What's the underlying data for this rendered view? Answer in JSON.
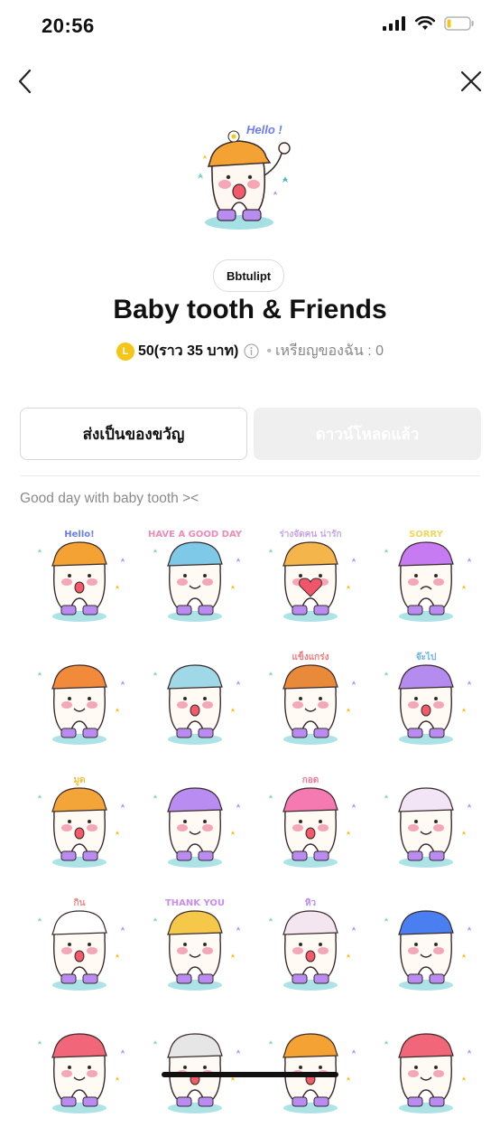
{
  "status_bar": {
    "time": "20:56"
  },
  "header": {
    "back_icon": "chevron-left-icon",
    "close_icon": "close-icon"
  },
  "sticker_pack": {
    "author": "Bbtulipt",
    "title": "Baby tooth & Friends",
    "coin_symbol": "L",
    "price": "50",
    "price_approx": "(ราว 35 บาท)",
    "my_coins": "เหรียญของฉัน : 0",
    "description": "Good day with baby tooth ><"
  },
  "actions": {
    "gift_label": "ส่งเป็นของขวัญ",
    "download_label": "ดาวน์โหลดแล้ว"
  },
  "stickers": [
    {
      "id": 1,
      "hat": "#f4a234",
      "text": "Hello!",
      "textColor": "#6b7cf6",
      "mouth": "open"
    },
    {
      "id": 2,
      "hat": "#7ec9e8",
      "text": "HAVE A GOOD DAY",
      "textColor": "#f08ab6",
      "mouth": "smile"
    },
    {
      "id": 3,
      "hat": "#f4b54a",
      "text": "ร่างจัดคน น่ารัก",
      "textColor": "#c9a4e6",
      "mouth": "heart"
    },
    {
      "id": 4,
      "hat": "#c77bf2",
      "text": "SORRY",
      "textColor": "#f3d55a",
      "mouth": "sad"
    },
    {
      "id": 5,
      "hat": "#f28a3c",
      "text": "",
      "textColor": "#999",
      "mouth": "smile"
    },
    {
      "id": 6,
      "hat": "#9fd8e6",
      "text": "",
      "textColor": "#999",
      "mouth": "open"
    },
    {
      "id": 7,
      "hat": "#e88a3a",
      "text": "แข็งแกร่ง",
      "textColor": "#f07a7a",
      "mouth": "smile"
    },
    {
      "id": 8,
      "hat": "#b48cf0",
      "text": "จ๊ะไป",
      "textColor": "#6bb0f0",
      "mouth": "open"
    },
    {
      "id": 9,
      "hat": "#f4a53a",
      "text": "มูด",
      "textColor": "#f0c040",
      "mouth": "open"
    },
    {
      "id": 10,
      "hat": "#b98cf2",
      "text": "",
      "textColor": "#999",
      "mouth": "smile"
    },
    {
      "id": 11,
      "hat": "#f57ab2",
      "text": "กอด",
      "textColor": "#f07a9a",
      "mouth": "open"
    },
    {
      "id": 12,
      "hat": "#f2e6f6",
      "text": "",
      "textColor": "#999",
      "mouth": "smile"
    },
    {
      "id": 13,
      "hat": "#ffffff",
      "text": "กิน",
      "textColor": "#f08a8a",
      "mouth": "open"
    },
    {
      "id": 14,
      "hat": "#f5c84a",
      "text": "THANK YOU",
      "textColor": "#c98cf0",
      "mouth": "smile"
    },
    {
      "id": 15,
      "hat": "#f3e6f0",
      "text": "หิว",
      "textColor": "#b98cf2",
      "mouth": "open"
    },
    {
      "id": 16,
      "hat": "#4a7ff2",
      "text": "",
      "textColor": "#999",
      "mouth": "smile"
    },
    {
      "id": 17,
      "hat": "#f2667a",
      "text": "",
      "textColor": "#999",
      "mouth": "smile"
    },
    {
      "id": 18,
      "hat": "#e6e6e6",
      "text": "",
      "textColor": "#999",
      "mouth": "open"
    },
    {
      "id": 19,
      "hat": "#f4a234",
      "text": "",
      "textColor": "#999",
      "mouth": "open"
    },
    {
      "id": 20,
      "hat": "#f2667a",
      "text": "",
      "textColor": "#999",
      "mouth": "smile"
    }
  ]
}
